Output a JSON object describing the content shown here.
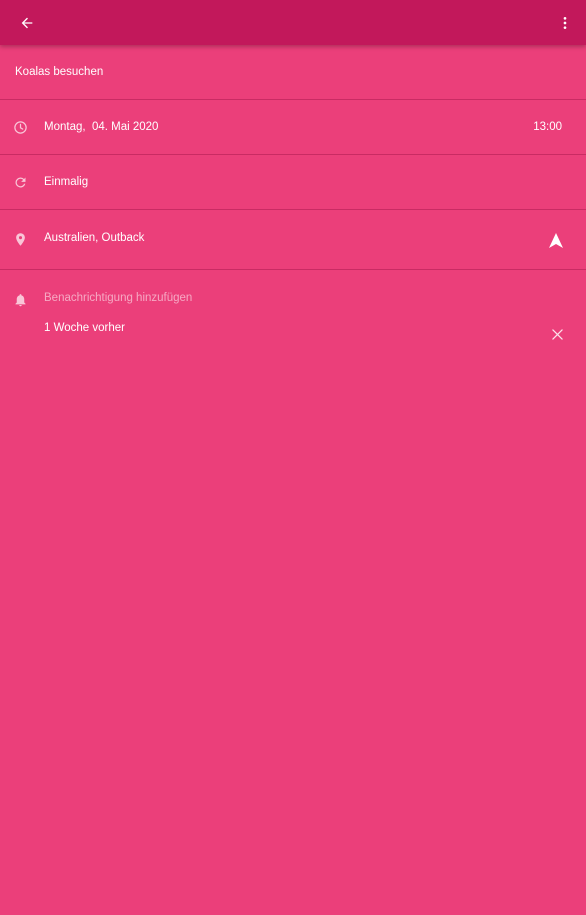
{
  "toolbar": {
    "back_icon": "arrow-back-icon",
    "menu_icon": "more-vert-icon",
    "background": "#c2185b"
  },
  "event": {
    "title": "Koalas besuchen",
    "date": "Montag,  04. Mai 2020",
    "time": "13:00",
    "repeat": "Einmalig",
    "location": "Australien, Outback"
  },
  "notifications": {
    "add_label": "Benachrichtigung hinzufügen",
    "items": [
      {
        "label": "1 Woche vorher"
      }
    ]
  },
  "colors": {
    "background": "#eb3f7a",
    "text": "#ffffff",
    "muted_text": "rgba(255,255,255,0.55)"
  }
}
